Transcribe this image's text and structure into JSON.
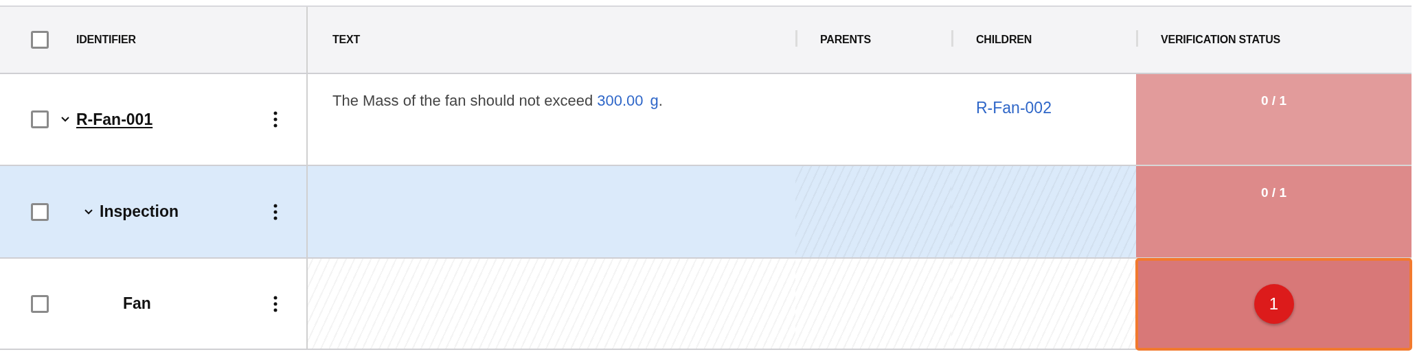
{
  "table": {
    "header_checked": false,
    "columns": [
      {
        "label": "IDENTIFIER"
      },
      {
        "label": "TEXT"
      },
      {
        "label": "PARENTS"
      },
      {
        "label": "CHILDREN"
      },
      {
        "label": "VERIFICATION STATUS"
      }
    ],
    "rows": [
      {
        "checked": false,
        "selected": false,
        "expanded": true,
        "linked": true,
        "identifier": "R-Fan-001",
        "text": {
          "hatched": false,
          "parts": [
            {
              "kind": "plain",
              "text": "The Mass of the fan should not exceed "
            },
            {
              "kind": "value",
              "text": "300.00"
            },
            {
              "kind": "unit",
              "text": "g"
            },
            {
              "kind": "plain",
              "text": "."
            }
          ]
        },
        "parents": {
          "hatched": false
        },
        "children": {
          "hatched": false,
          "links": [
            "R-Fan-002"
          ]
        },
        "status": {
          "kind": "ratio",
          "text": "0 / 1",
          "color": "#e29b9b",
          "focused": false
        }
      },
      {
        "checked": false,
        "selected": true,
        "expanded": true,
        "linked": false,
        "identifier": "Inspection",
        "text": {
          "hatched": false
        },
        "parents": {
          "hatched": true
        },
        "children": {
          "hatched": true
        },
        "status": {
          "kind": "ratio",
          "text": "0 / 1",
          "color": "#dd8a8a",
          "focused": false
        }
      },
      {
        "checked": false,
        "selected": false,
        "linked": false,
        "identifier": "Fan",
        "text": {
          "hatched": true
        },
        "parents": {
          "hatched": true
        },
        "children": {
          "hatched": true
        },
        "status": {
          "kind": "count",
          "text": "1",
          "color": "#d87878",
          "focused": true
        }
      }
    ]
  }
}
